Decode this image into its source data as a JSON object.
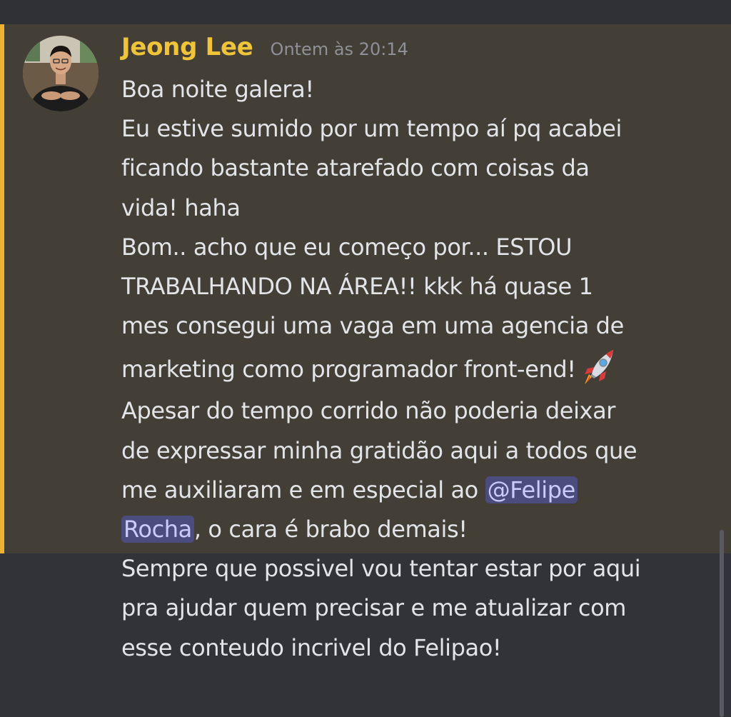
{
  "message": {
    "author": "Jeong Lee",
    "timestamp": "Ontem às 20:14",
    "colors": {
      "author": "#f0c43a",
      "highlight_bg": "#433f37",
      "highlight_bar": "#f0b232",
      "mention_bg": "#4b4d7e",
      "mention_text": "#c9cdfb",
      "text": "#e3e4e8",
      "background": "#313338"
    },
    "lines": [
      "Boa noite galera!",
      "Eu estive sumido por um tempo aí pq acabei",
      "ficando bastante atarefado com coisas da",
      "vida! haha",
      "Bom.. acho que eu começo por... ESTOU",
      "TRABALHANDO NA ÁREA!! kkk há quase 1",
      "mes consegui uma vaga em uma agencia de",
      "marketing como programador front-end!",
      "Apesar do tempo corrido não poderia deixar",
      "de expressar minha gratidão aqui a todos que",
      "me auxiliaram e em especial ao ",
      "@Felipe",
      "Rocha",
      ", o cara é brabo demais!",
      "Sempre que possivel vou tentar estar por aqui",
      "pra ajudar quem precisar e me atualizar com",
      "esse conteudo incrivel do Felipao!"
    ],
    "emoji_icon": "rocket-emoji-icon"
  }
}
